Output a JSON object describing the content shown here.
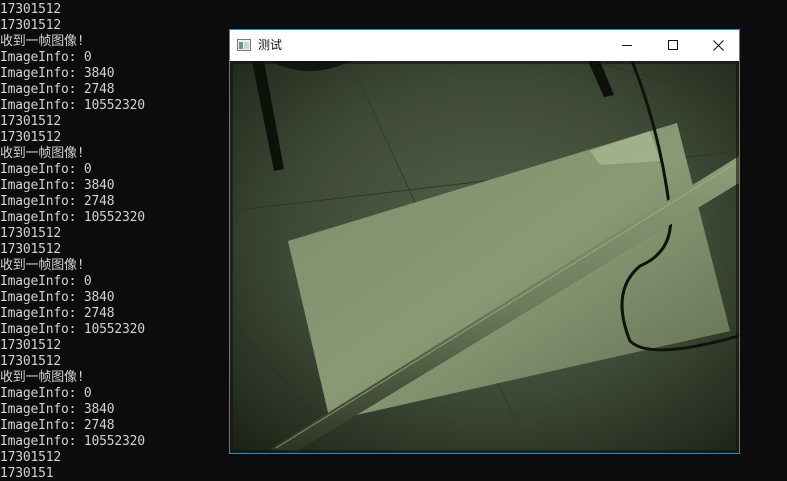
{
  "console": {
    "lines": [
      "17301512",
      "17301512",
      "收到一帧图像!",
      "ImageInfo: 0",
      "ImageInfo: 3840",
      "ImageInfo: 2748",
      "ImageInfo: 10552320",
      "17301512",
      "17301512",
      "收到一帧图像!",
      "ImageInfo: 0",
      "ImageInfo: 3840",
      "ImageInfo: 2748",
      "ImageInfo: 10552320",
      "17301512",
      "17301512",
      "收到一帧图像!",
      "ImageInfo: 0",
      "ImageInfo: 3840",
      "ImageInfo: 2748",
      "ImageInfo: 10552320",
      "17301512",
      "17301512",
      "收到一帧图像!",
      "ImageInfo: 0",
      "ImageInfo: 3840",
      "ImageInfo: 2748",
      "ImageInfo: 10552320",
      "17301512",
      "1730151"
    ]
  },
  "window": {
    "title": "测试",
    "icon": "app-window-icon",
    "controls": [
      "minimize-icon",
      "maximize-icon",
      "close-icon"
    ],
    "border_color": "#1e90d8"
  },
  "camera_frame": {
    "subject": "camera-image",
    "tint": "#6b7a58"
  }
}
